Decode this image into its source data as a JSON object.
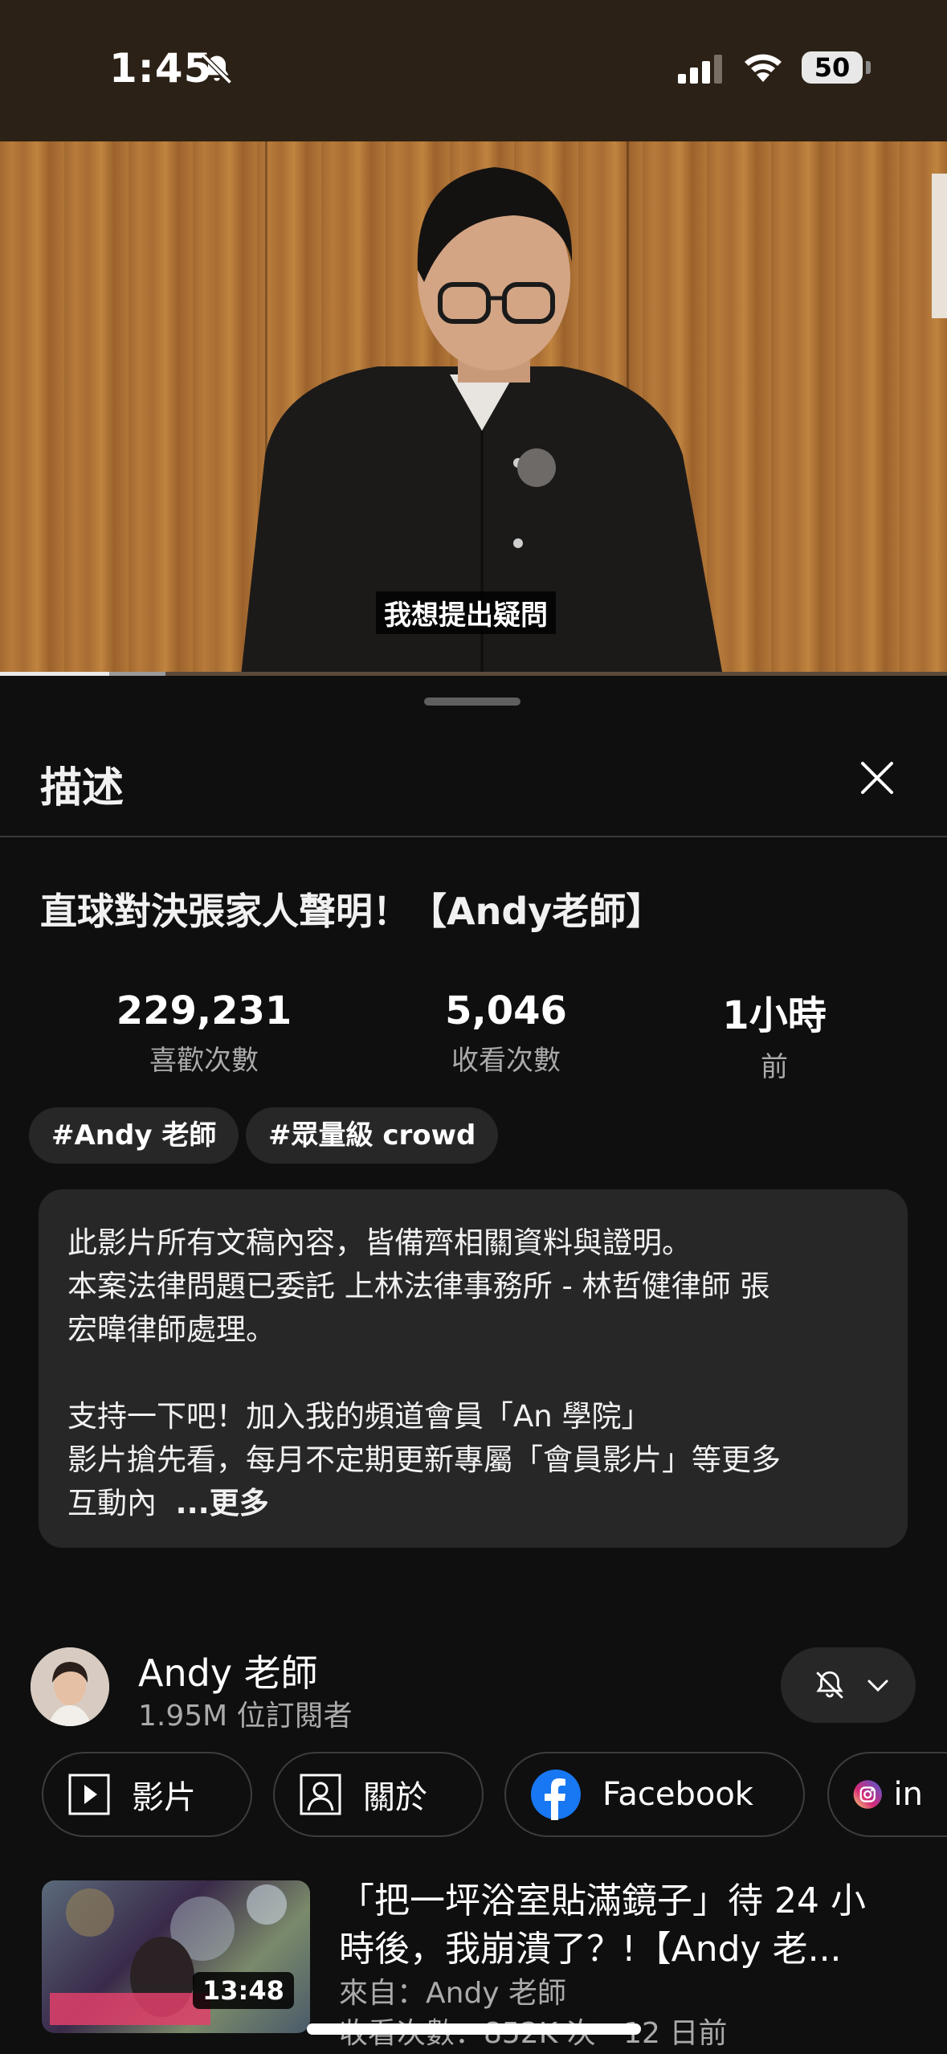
{
  "status_bar": {
    "time": "1:45",
    "battery": "50"
  },
  "video": {
    "subtitle": "我想提出疑問",
    "progress": 0.115
  },
  "description_sheet": {
    "title": "描述",
    "video_title": "直球對決張家人聲明！【Andy老師】",
    "stats": [
      {
        "value": "229,231",
        "label": "喜歡次數"
      },
      {
        "value": "5,046",
        "label": "收看次數"
      },
      {
        "value": "1小時",
        "label": "前"
      }
    ],
    "tags": [
      "#Andy 老師",
      "#眾量級 crowd"
    ],
    "description_lines": [
      "此影片所有文稿內容，皆備齊相關資料與證明。",
      "本案法律問題已委託 上林法律事務所 - 林哲健律師  張",
      "宏暐律師處理。",
      "",
      "支持一下吧！加入我的頻道會員「An 學院」",
      "影片搶先看，每月不定期更新專屬「會員影片」等更多",
      "互動內"
    ],
    "more_label": "...更多"
  },
  "channel": {
    "name": "Andy 老師",
    "subscribers": "1.95M 位訂閱者"
  },
  "channel_links": [
    {
      "label": "影片",
      "icon": "play-icon"
    },
    {
      "label": "關於",
      "icon": "person-icon"
    },
    {
      "label": "Facebook",
      "icon": "facebook-icon"
    },
    {
      "label": "in",
      "icon": "instagram-icon"
    }
  ],
  "related_video": {
    "title_line1": "「把一坪浴室貼滿鏡子」待 24 小",
    "title_line2": "時後，我崩潰了？!【Andy 老...",
    "channel": "來自：Andy 老師",
    "meta": "收看次數：852K 次 · 12 日前",
    "duration": "13:48"
  },
  "colors": {
    "background": "#0f0f0f",
    "card": "#272727",
    "secondary_text": "#aaaaaa",
    "facebook_blue": "#1877f2"
  }
}
